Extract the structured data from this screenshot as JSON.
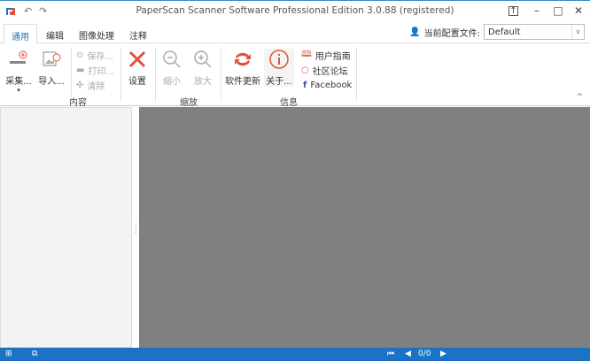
{
  "title": "PaperScan Scanner Software Professional Edition 3.0.88 (registered)",
  "tabs": [
    "通用",
    "编辑",
    "图像处理",
    "注释"
  ],
  "profile": {
    "label": "当前配置文件:",
    "value": "Default"
  },
  "ribbon": {
    "acquire": "采集...",
    "import": "导入...",
    "save": "保存...",
    "print": "打印...",
    "clear": "清除",
    "settings": "设置",
    "zoom_out": "缩小",
    "zoom_in": "放大",
    "update": "软件更新",
    "about": "关于...",
    "guide": "用户指南",
    "forum": "社区论坛",
    "facebook": "Facebook",
    "groups": {
      "content": "内容",
      "zoom": "缩放",
      "info": "信息"
    }
  },
  "status": {
    "page": "0/0"
  },
  "colors": {
    "accent": "#1c73c4",
    "icon": "#e0533b"
  }
}
